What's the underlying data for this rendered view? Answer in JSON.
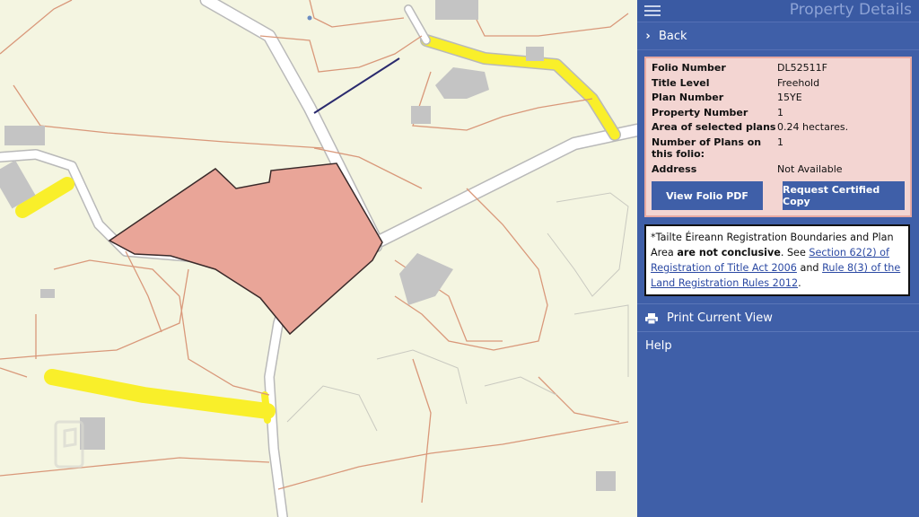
{
  "panel": {
    "title": "Property Details",
    "back_label": "Back",
    "details": [
      {
        "label": "Folio Number",
        "value": "DL52511F"
      },
      {
        "label": "Title Level",
        "value": "Freehold"
      },
      {
        "label": "Plan Number",
        "value": "15YE"
      },
      {
        "label": "Property Number",
        "value": "1"
      },
      {
        "label": "Area of selected plans",
        "value": "0.24 hectares."
      },
      {
        "label": "Number of Plans on this folio:",
        "value": "1"
      },
      {
        "label": "Address",
        "value": "Not Available"
      }
    ],
    "view_pdf_label": "View Folio PDF",
    "request_copy_label": "Request Certified Copy",
    "notice": {
      "text1": "*Tailte Éireann Registration Boundaries and Plan Area ",
      "bold": "are not conclusive",
      "text2": ". See ",
      "link1": "Section 62(2) of Registration of Title Act 2006",
      "text3": " and ",
      "link2": "Rule 8(3) of the Land Registration Rules 2012",
      "text4": "."
    },
    "print_label": "Print Current View",
    "help_label": "Help"
  },
  "icons": {
    "menu": "hamburger-icon",
    "back": "chevron-right-icon",
    "print": "printer-icon"
  },
  "colors": {
    "panel_bg": "#3f5fa8",
    "selected_parcel": "#e9a598",
    "details_bg": "#f3d5d2",
    "road_highlight": "#f9ef2a"
  }
}
